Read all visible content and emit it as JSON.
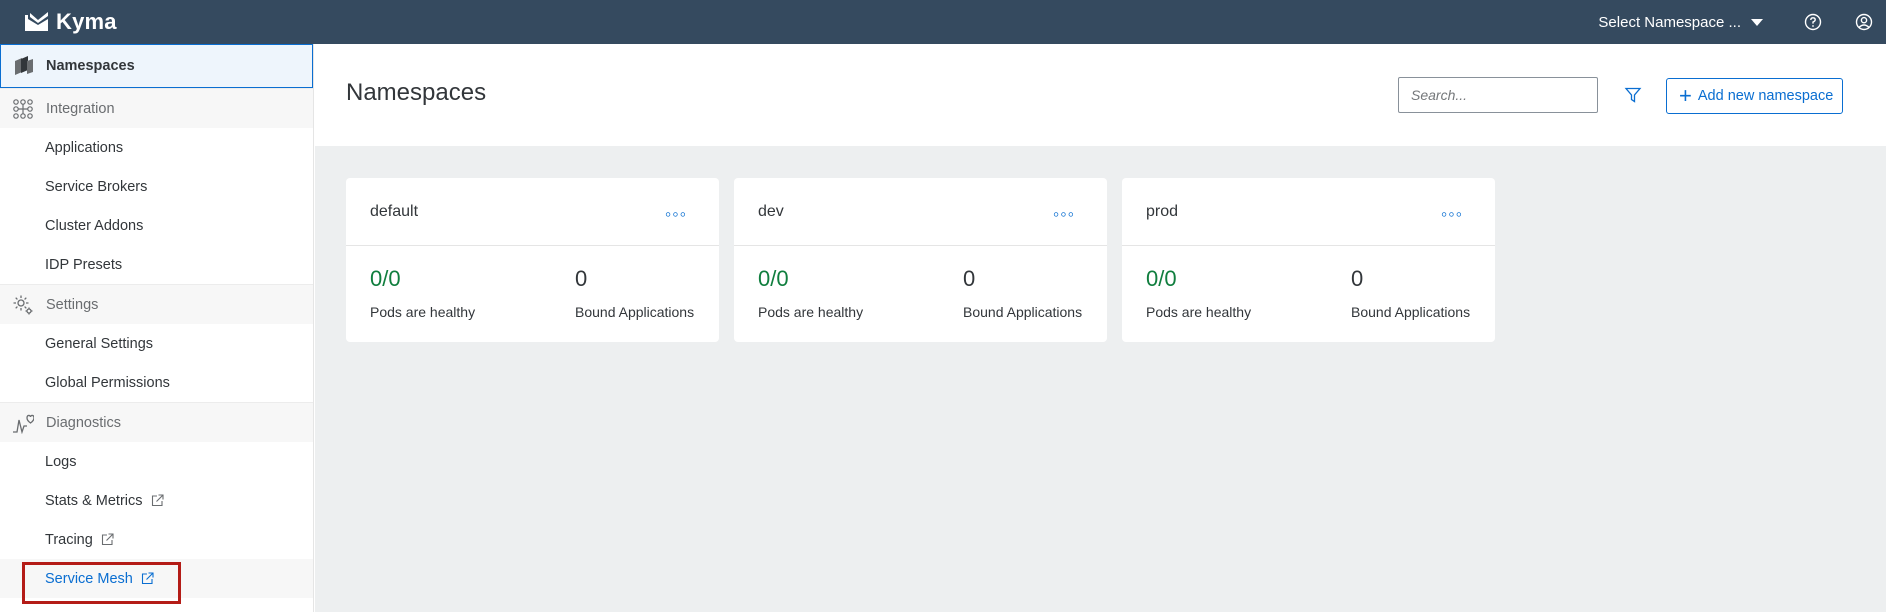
{
  "app": {
    "name": "Kyma"
  },
  "topbar": {
    "namespace_select": "Select Namespace ...",
    "help_icon": "help-icon",
    "user_icon": "user-icon"
  },
  "sidebar": {
    "top": {
      "label": "Namespaces",
      "icon": "namespaces-icon"
    },
    "sections": [
      {
        "label": "Integration",
        "icon": "integration-icon",
        "items": [
          {
            "label": "Applications"
          },
          {
            "label": "Service Brokers"
          },
          {
            "label": "Cluster Addons"
          },
          {
            "label": "IDP Presets"
          }
        ]
      },
      {
        "label": "Settings",
        "icon": "gear-icon",
        "items": [
          {
            "label": "General Settings"
          },
          {
            "label": "Global Permissions"
          }
        ]
      },
      {
        "label": "Diagnostics",
        "icon": "diagnostics-icon",
        "items": [
          {
            "label": "Logs"
          },
          {
            "label": "Stats & Metrics",
            "external": true
          },
          {
            "label": "Tracing",
            "external": true
          },
          {
            "label": "Service Mesh",
            "external": true
          }
        ]
      }
    ]
  },
  "main": {
    "title": "Namespaces",
    "search_placeholder": "Search...",
    "add_button": "Add new namespace",
    "cards": [
      {
        "name": "default",
        "pods": "0/0",
        "pods_label": "Pods are healthy",
        "apps": "0",
        "apps_label": "Bound Applications"
      },
      {
        "name": "dev",
        "pods": "0/0",
        "pods_label": "Pods are healthy",
        "apps": "0",
        "apps_label": "Bound Applications"
      },
      {
        "name": "prod",
        "pods": "0/0",
        "pods_label": "Pods are healthy",
        "apps": "0",
        "apps_label": "Bound Applications"
      }
    ]
  },
  "colors": {
    "shell": "#354a5f",
    "accent": "#0a6ed1",
    "healthy": "#107e3e",
    "highlight": "#b41c17"
  }
}
